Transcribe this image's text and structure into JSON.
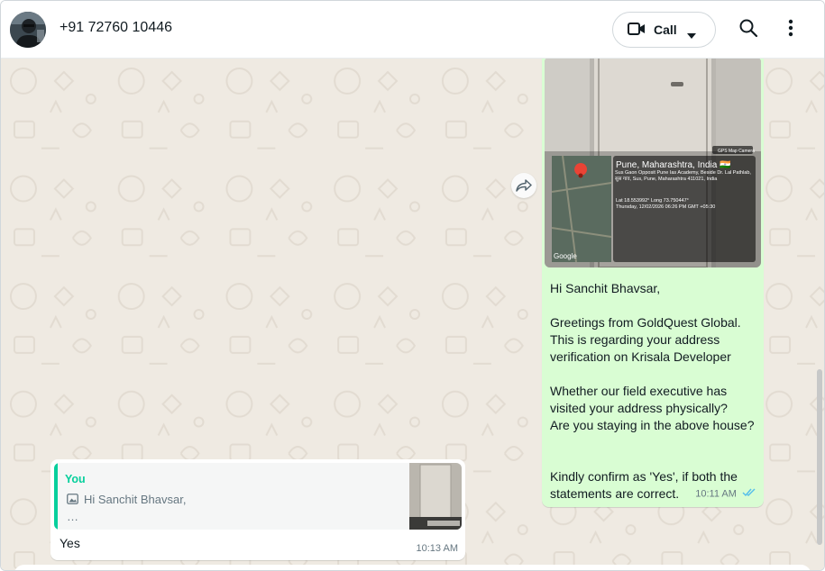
{
  "header": {
    "contact_name": "+91 72760 10446",
    "call_label": "Call",
    "icons": [
      "video-camera-icon",
      "chevron-down-icon",
      "search-icon",
      "more-vertical-icon"
    ]
  },
  "messages": {
    "outgoing": {
      "photo_overlay": {
        "location": "Pune, Maharashtra, India 🇮🇳",
        "address": "Sus Gaon Opposit Pune Ias Academy, Beside Dr. Lal Pathlab, सुस गाव, Sus, Pune, Maharashtra 411021, India",
        "coords": "Lat 18.553992° Long 73.750447°",
        "datetime": "Thursday, 12/02/2026 06:26 PM GMT +05:30",
        "map_brand": "Google",
        "camera_brand": "GPS Map Camera"
      },
      "text": "Hi Sanchit Bhavsar,\n\nGreetings from GoldQuest Global.\nThis is regarding your address verification on Krisala Developer\n\nWhether our field executive has visited your address physically?\nAre you staying in the above house?\n\n\nKindly confirm as 'Yes', if both the statements are correct.",
      "time": "10:11 AM",
      "status": "read",
      "tick_color": "#53bdeb"
    },
    "incoming": {
      "quote_author": "You",
      "quote_text": "Hi Sanchit Bhavsar,",
      "quote_ellipsis": "…",
      "text": "Yes",
      "time": "10:13 AM"
    }
  },
  "colors": {
    "outgoing_bubble": "#d9fdd3",
    "incoming_bubble": "#ffffff",
    "chat_background": "#efeae2",
    "quote_accent": "#06cf9c"
  }
}
